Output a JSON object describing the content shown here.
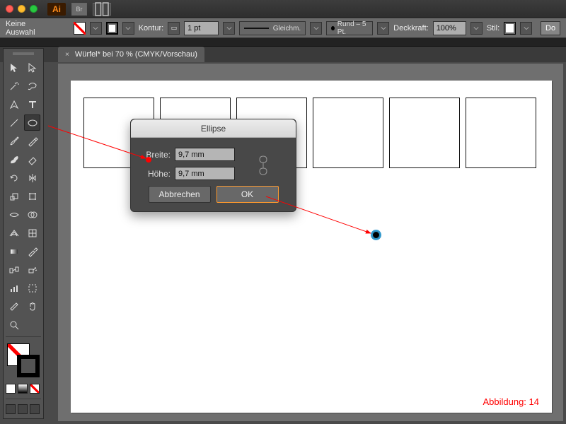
{
  "window": {
    "app": "Ai"
  },
  "options_bar": {
    "selection_label": "Keine Auswahl",
    "stroke_label": "Kontur:",
    "stroke_weight": "1 pt",
    "stroke_style_label": "Gleichm.",
    "brush_label": "Rund – 5 Pt.",
    "opacity_label": "Deckkraft:",
    "opacity_value": "100%",
    "style_label": "Stil:",
    "doc_setup": "Do"
  },
  "tab": {
    "close": "×",
    "title": "Würfel* bei 70 % (CMYK/Vorschau)"
  },
  "dialog": {
    "title": "Ellipse",
    "width_label": "Breite:",
    "width_value": "9,7 mm",
    "height_label": "Höhe:",
    "height_value": "9,7 mm",
    "cancel": "Abbrechen",
    "ok": "OK"
  },
  "annotation": {
    "caption": "Abbildung: 14"
  }
}
